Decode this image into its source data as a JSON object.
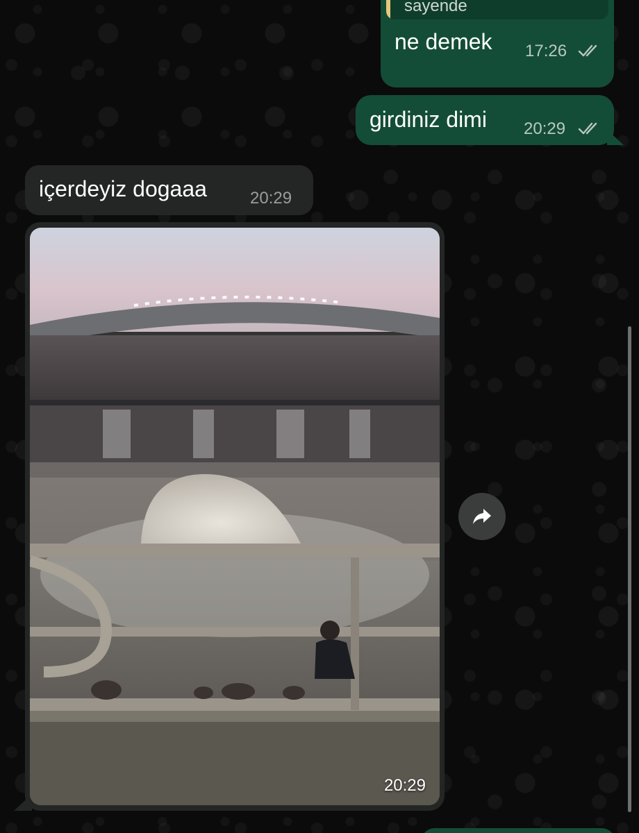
{
  "messages": {
    "quoted": {
      "text": "sayende"
    },
    "out_1": {
      "text": "ne demek",
      "time": "17:26",
      "status": "read-double-check"
    },
    "out_2": {
      "text": "girdiniz dimi",
      "time": "20:29",
      "status": "read-double-check"
    },
    "in_1": {
      "text": "içerdeyiz dogaaa",
      "time": "20:29"
    },
    "in_media": {
      "time": "20:29",
      "content": "photo",
      "icon": "forward-icon"
    }
  },
  "colors": {
    "background": "#0b0b0b",
    "outgoing_bubble": "#144d37",
    "incoming_bubble": "#242626",
    "quote_accent": "#e5c97a"
  }
}
